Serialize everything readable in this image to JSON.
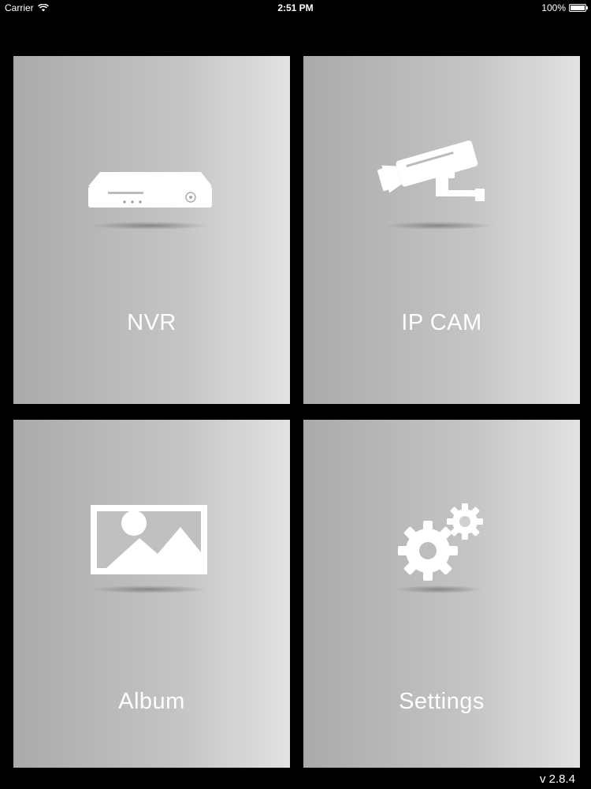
{
  "status_bar": {
    "carrier": "Carrier",
    "time": "2:51 PM",
    "battery": "100%",
    "battery_level": 1.0
  },
  "tiles": [
    {
      "label": "NVR",
      "icon": "nvr-device-icon"
    },
    {
      "label": "IP CAM",
      "icon": "security-camera-icon"
    },
    {
      "label": "Album",
      "icon": "image-icon"
    },
    {
      "label": "Settings",
      "icon": "gears-icon"
    }
  ],
  "version": "v 2.8.4",
  "colors": {
    "background": "#000000",
    "tile_gradient_start": "#aaaaaa",
    "tile_gradient_end": "#e2e2e4",
    "text": "#ffffff"
  }
}
